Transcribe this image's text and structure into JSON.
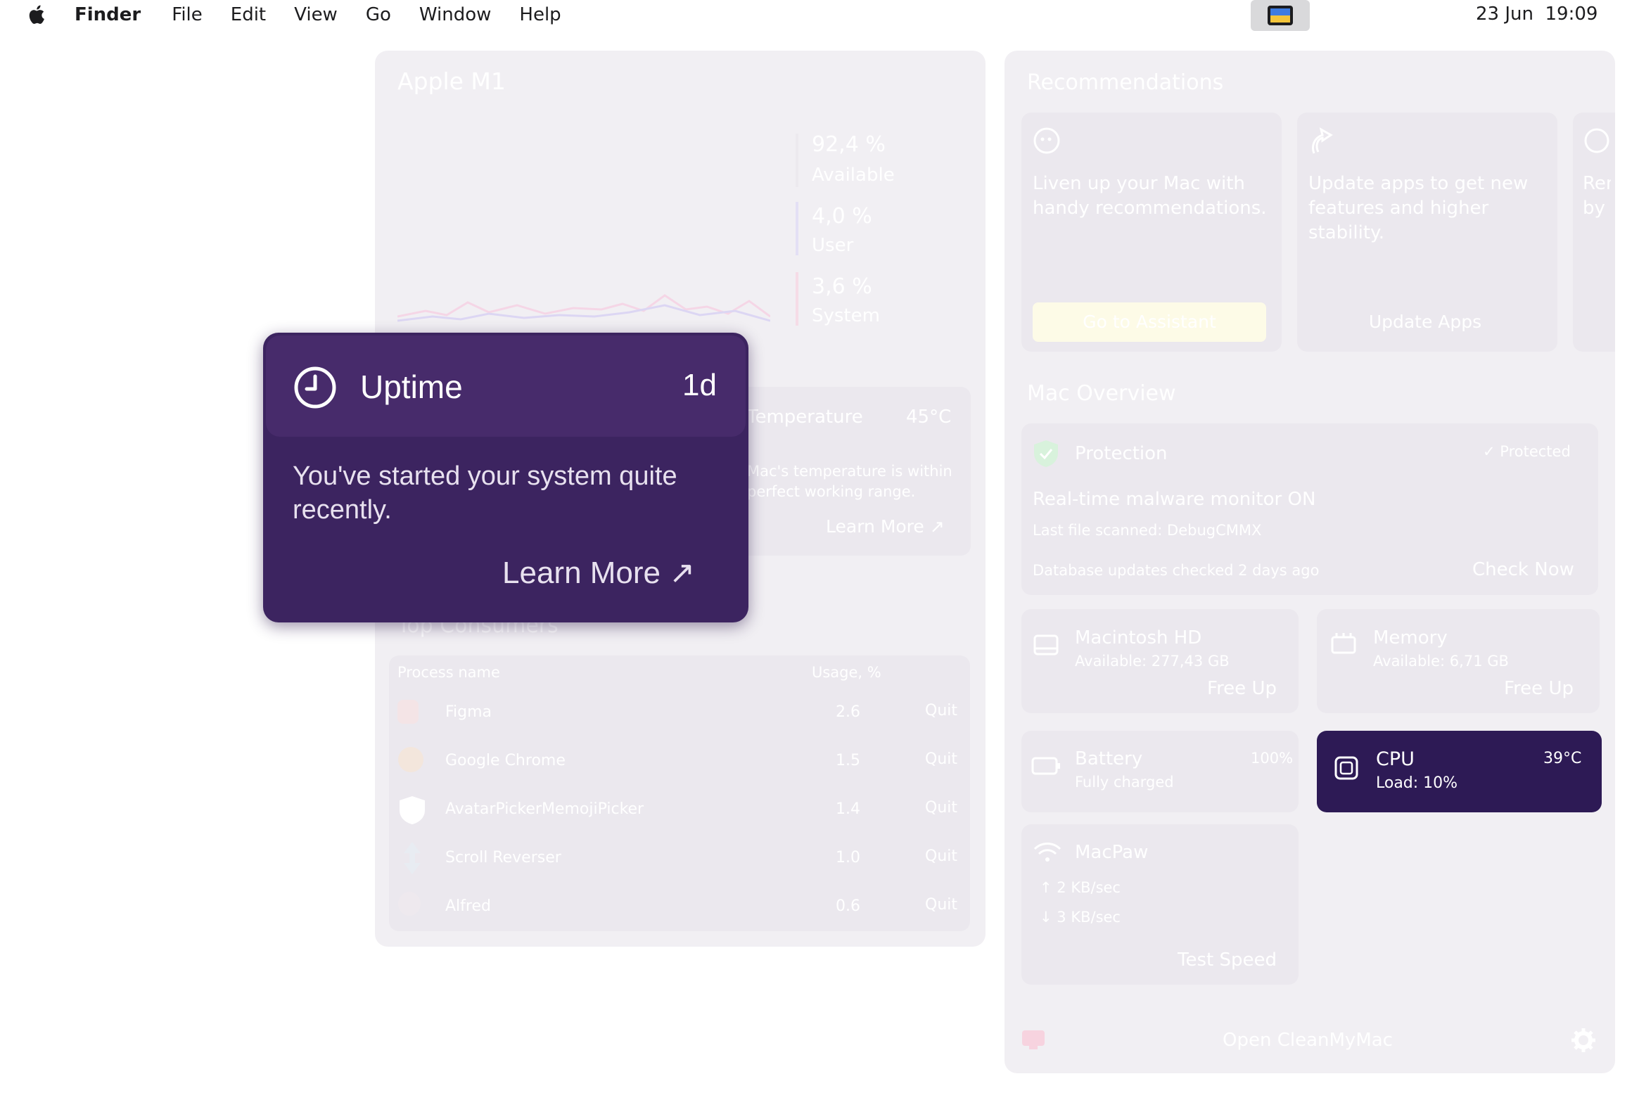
{
  "menubar": {
    "app_name": "Finder",
    "items": [
      "File",
      "Edit",
      "View",
      "Go",
      "Window",
      "Help"
    ],
    "date": "23 Jun",
    "time": "19:09"
  },
  "processor": {
    "title": "Apple M1",
    "available_value": "92,4 %",
    "available_label": "Available",
    "user_value": "4,0 %",
    "user_label": "User",
    "system_value": "3,6 %",
    "system_label": "System"
  },
  "temperature": {
    "title": "Temperature",
    "value": "45°C",
    "description": "Mac's temperature is within perfect working range.",
    "learn_more": "Learn More ↗"
  },
  "uptime": {
    "title": "Uptime",
    "value": "1d",
    "description": "You've started your system quite recently.",
    "learn_more": "Learn More ↗"
  },
  "top_consumers": {
    "title": "Top Consumers",
    "col_process": "Process name",
    "col_usage": "Usage, %",
    "rows": [
      {
        "name": "Figma",
        "usage": "2.6",
        "action": "Quit"
      },
      {
        "name": "Google Chrome",
        "usage": "1.5",
        "action": "Quit"
      },
      {
        "name": "AvatarPickerMemojiPicker",
        "usage": "1.4",
        "action": "Quit"
      },
      {
        "name": "Scroll Reverser",
        "usage": "1.0",
        "action": "Quit"
      },
      {
        "name": "Alfred",
        "usage": "0.6",
        "action": "Quit"
      }
    ]
  },
  "recommendations": {
    "title": "Recommendations",
    "cards": [
      {
        "text": "Liven up your Mac with handy recommendations.",
        "button": "Go to Assistant"
      },
      {
        "text": "Update apps to get new features and higher stability.",
        "button": "Update Apps"
      },
      {
        "text": "Rem by"
      }
    ]
  },
  "overview": {
    "title": "Mac Overview",
    "protection": {
      "title": "Protection",
      "status": "Protected",
      "monitor": "Real-time malware monitor ON",
      "last_file": "Last file scanned: DebugCMMX",
      "database": "Database updates checked 2 days ago",
      "action": "Check Now"
    },
    "disk": {
      "title": "Macintosh HD",
      "subtitle": "Available: 277,43 GB",
      "action": "Free Up"
    },
    "memory": {
      "title": "Memory",
      "subtitle": "Available: 6,71 GB",
      "action": "Free Up"
    },
    "battery": {
      "title": "Battery",
      "value": "100%",
      "subtitle": "Fully charged"
    },
    "cpu": {
      "title": "CPU",
      "value": "39°C",
      "subtitle": "Load: 10%"
    },
    "network": {
      "title": "MacPaw",
      "upload": "2 KB/sec",
      "download": "3 KB/sec",
      "action": "Test Speed"
    }
  },
  "footer": {
    "open_app": "Open CleanMyMac"
  },
  "colors": {
    "uptime_bg": "#3c2460",
    "cpu_bg": "#2d1a55",
    "assistant_button": "#fdfbe7"
  }
}
